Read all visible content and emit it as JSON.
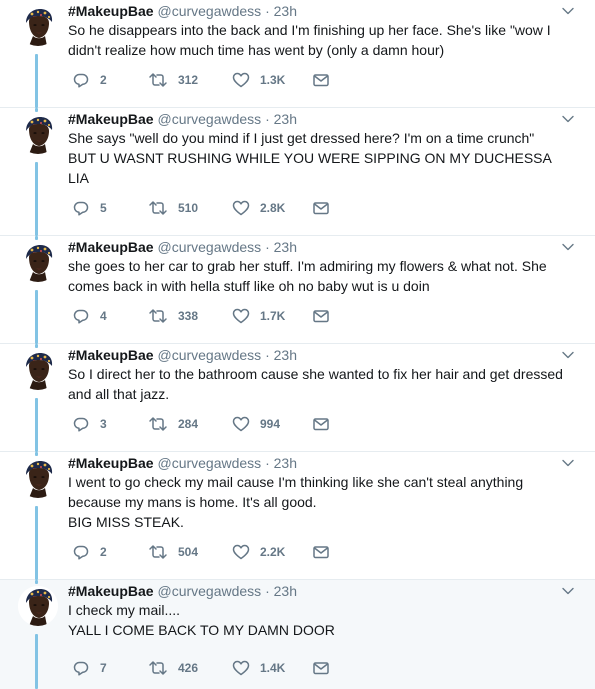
{
  "tweets": [
    {
      "name": "#MakeupBae",
      "handle": "@curvegawdess",
      "sep": "·",
      "time": "23h",
      "lines": [
        "So he disappears into the back and I'm finishing up her face. She's like \"wow I",
        "didn't realize how much time has went by (only a damn hour)"
      ],
      "replies": "2",
      "retweets": "312",
      "likes": "1.3K"
    },
    {
      "name": "#MakeupBae",
      "handle": "@curvegawdess",
      "sep": "·",
      "time": "23h",
      "lines": [
        "She says \"well do you mind if I just get dressed here? I'm on a time crunch\"",
        "BUT U WASNT RUSHING WHILE YOU WERE SIPPING ON MY DUCHESSA",
        "LIA"
      ],
      "replies": "5",
      "retweets": "510",
      "likes": "2.8K"
    },
    {
      "name": "#MakeupBae",
      "handle": "@curvegawdess",
      "sep": "·",
      "time": "23h",
      "lines": [
        "she goes to her car to grab her stuff. I'm admiring my flowers & what not. She",
        "comes back in with hella stuff like oh no baby wut is u doin"
      ],
      "replies": "4",
      "retweets": "338",
      "likes": "1.7K"
    },
    {
      "name": "#MakeupBae",
      "handle": "@curvegawdess",
      "sep": "·",
      "time": "23h",
      "lines": [
        "So I direct her to the bathroom cause she wanted to fix her hair and get dressed",
        "and all that jazz."
      ],
      "replies": "3",
      "retweets": "284",
      "likes": "994"
    },
    {
      "name": "#MakeupBae",
      "handle": "@curvegawdess",
      "sep": "·",
      "time": "23h",
      "lines": [
        "I went to go check my mail cause I'm thinking like she can't steal anything",
        "because my mans is home. It's all good.",
        "BIG MISS STEAK."
      ],
      "replies": "2",
      "retweets": "504",
      "likes": "2.2K"
    },
    {
      "name": "#MakeupBae",
      "handle": "@curvegawdess",
      "sep": "·",
      "time": "23h",
      "lines": [
        "I check my mail....",
        "YALL I COME BACK TO MY DAMN DOOR"
      ],
      "replies": "7",
      "retweets": "426",
      "likes": "1.4K"
    }
  ],
  "icons": {
    "reply": "reply-icon",
    "retweet": "retweet-icon",
    "like": "heart-icon",
    "message": "envelope-icon",
    "more": "chevron-down-icon"
  },
  "colors": {
    "thread_line": "#82c3e4",
    "secondary_text": "#657786",
    "highlight_bg": "#f5f8fa"
  }
}
